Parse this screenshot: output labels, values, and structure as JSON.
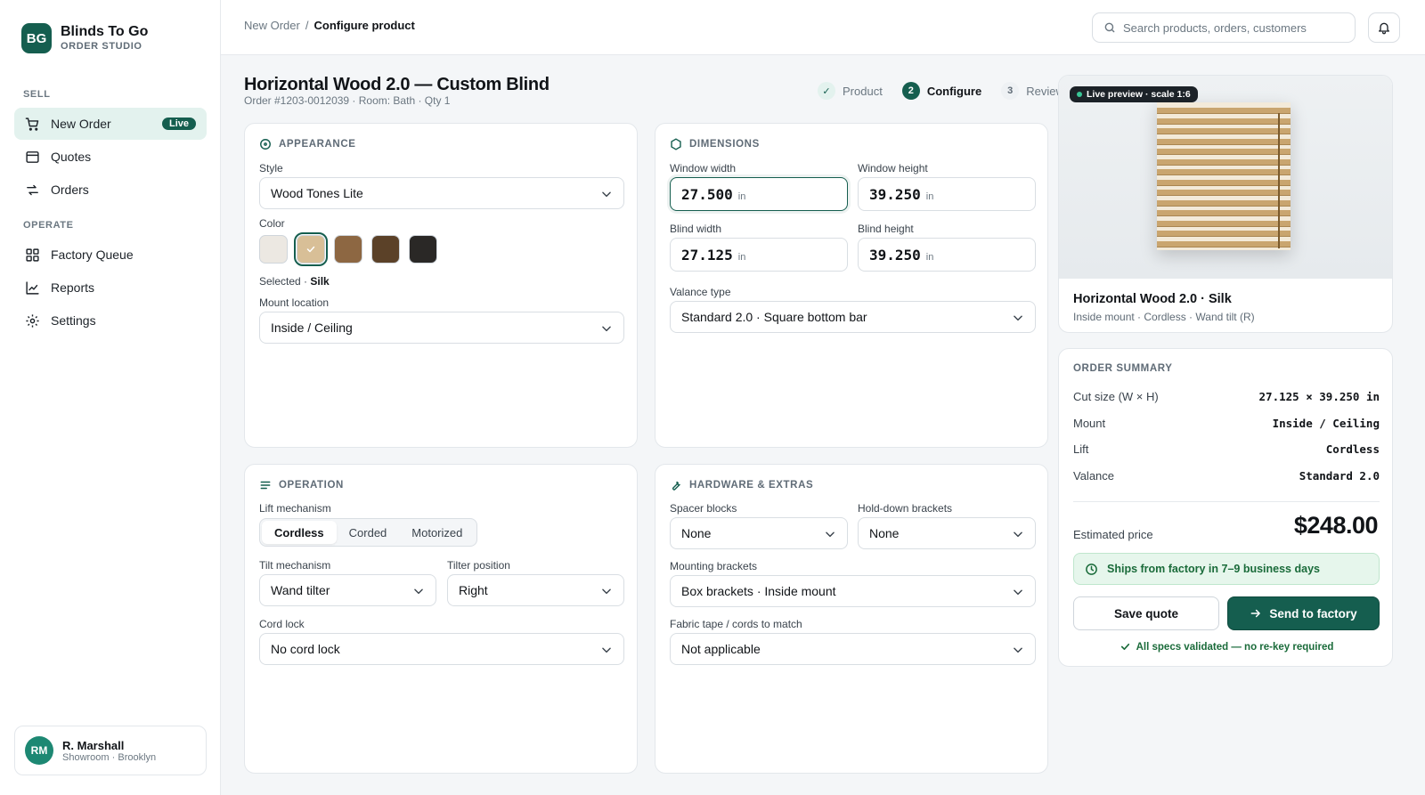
{
  "brand": {
    "logo": "BG",
    "name": "Blinds To Go",
    "subtitle": "ORDER STUDIO"
  },
  "sidebar": {
    "sections": [
      {
        "label": "SELL"
      },
      {
        "label": "OPERATE"
      }
    ],
    "items": [
      {
        "label": "New Order",
        "icon": "cart-icon",
        "badge": "Live",
        "active": true
      },
      {
        "label": "Quotes",
        "icon": "quote-icon"
      },
      {
        "label": "Orders",
        "icon": "swap-icon"
      },
      {
        "label": "Factory Queue",
        "icon": "grid-icon"
      },
      {
        "label": "Reports",
        "icon": "chart-icon"
      },
      {
        "label": "Settings",
        "icon": "gear-icon"
      }
    ],
    "user": {
      "initials": "RM",
      "name": "R. Marshall",
      "location": "Showroom · Brooklyn"
    }
  },
  "topbar": {
    "breadcrumb": {
      "parent": "New Order",
      "separator": "/",
      "current": "Configure product"
    },
    "search_placeholder": "Search products, orders, customers"
  },
  "header": {
    "title": "Horizontal Wood 2.0 — Custom Blind",
    "subtitle": "Order #1203-0012039 · Room: Bath · Qty 1",
    "steps": [
      {
        "marker": "✓",
        "label": "Product",
        "state": "done"
      },
      {
        "marker": "2",
        "label": "Configure",
        "state": "active"
      },
      {
        "marker": "3",
        "label": "Review",
        "state": "todo"
      }
    ]
  },
  "appearance": {
    "title": "APPEARANCE",
    "style_label": "Style",
    "style_value": "Wood Tones Lite",
    "color_label": "Color",
    "swatches": [
      {
        "color": "#ece8e2"
      },
      {
        "color": "#d8bf97",
        "selected": true
      },
      {
        "color": "#8d6742"
      },
      {
        "color": "#5b4128"
      },
      {
        "color": "#2a2826"
      }
    ],
    "selected_prefix": "Selected · ",
    "selected_value": "Silk",
    "mount_label": "Mount location",
    "mount_value": "Inside / Ceiling"
  },
  "dimensions": {
    "title": "DIMENSIONS",
    "window_width_label": "Window width",
    "window_width": "27.500",
    "window_height_label": "Window height",
    "window_height": "39.250",
    "blind_width_label": "Blind width",
    "blind_width": "27.125",
    "blind_height_label": "Blind height",
    "blind_height": "39.250",
    "unit": "in",
    "valance_label": "Valance type",
    "valance_value": "Standard 2.0 · Square bottom bar"
  },
  "operation": {
    "title": "OPERATION",
    "lift_label": "Lift mechanism",
    "lift_options": [
      "Cordless",
      "Corded",
      "Motorized"
    ],
    "tilt_label": "Tilt mechanism",
    "tilt_value": "Wand tilter",
    "tilter_position_label": "Tilter position",
    "tilter_position_value": "Right",
    "cord_lock_label": "Cord lock",
    "cord_lock_value": "No cord lock"
  },
  "hardware": {
    "title": "HARDWARE & EXTRAS",
    "spacer_label": "Spacer blocks",
    "spacer_value": "None",
    "holddown_label": "Hold-down brackets",
    "holddown_value": "None",
    "mounting_label": "Mounting brackets",
    "mounting_value": "Box brackets · Inside mount",
    "tape_label": "Fabric tape / cords to match",
    "tape_value": "Not applicable"
  },
  "preview": {
    "tag": "Live preview · scale 1:6",
    "name": "Horizontal Wood 2.0 · Silk",
    "details": "Inside mount · Cordless · Wand tilt (R)"
  },
  "summary": {
    "title": "ORDER SUMMARY",
    "rows": [
      {
        "label": "Cut size (W × H)",
        "value": "27.125 × 39.250 in"
      },
      {
        "label": "Mount",
        "value": "Inside / Ceiling"
      },
      {
        "label": "Lift",
        "value": "Cordless"
      },
      {
        "label": "Valance",
        "value": "Standard 2.0"
      }
    ],
    "est_label": "Estimated price",
    "est_price": "$248.00",
    "ship_text": "Ships from factory in 7–9 business days",
    "save_label": "Save quote",
    "send_label": "Send to factory",
    "validated_text": "All specs validated — no re-key required"
  },
  "colors": {
    "brand": "#155e4f",
    "success": "#1a6b3a",
    "border": "#e3e7eb"
  }
}
